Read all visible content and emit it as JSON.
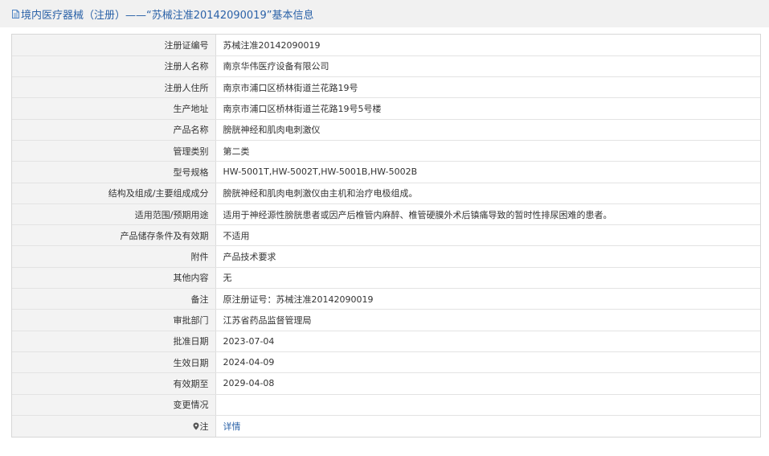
{
  "header": {
    "icon": "document-icon",
    "title": "境内医疗器械（注册）——“苏械注准20142090019”基本信息",
    "accent_color": "#2b62a8"
  },
  "rows": [
    {
      "label": "注册证编号",
      "value": "苏械注准20142090019"
    },
    {
      "label": "注册人名称",
      "value": "南京华伟医疗设备有限公司"
    },
    {
      "label": "注册人住所",
      "value": "南京市浦口区桥林街道兰花路19号"
    },
    {
      "label": "生产地址",
      "value": "南京市浦口区桥林街道兰花路19号5号楼"
    },
    {
      "label": "产品名称",
      "value": "膀胱神经和肌肉电刺激仪"
    },
    {
      "label": "管理类别",
      "value": "第二类"
    },
    {
      "label": "型号规格",
      "value": "HW-5001T,HW-5002T,HW-5001B,HW-5002B"
    },
    {
      "label": "结构及组成/主要组成成分",
      "value": "膀胱神经和肌肉电刺激仪由主机和治疗电极组成。"
    },
    {
      "label": "适用范围/预期用途",
      "value": "适用于神经源性膀胱患者或因产后椎管内麻醉、椎管硬膜外术后镇痛导致的暂时性排尿困难的患者。"
    },
    {
      "label": "产品储存条件及有效期",
      "value": "不适用"
    },
    {
      "label": "附件",
      "value": "产品技术要求"
    },
    {
      "label": "其他内容",
      "value": "无"
    },
    {
      "label": "备注",
      "value": "原注册证号：苏械注准20142090019"
    },
    {
      "label": "审批部门",
      "value": "江苏省药品监督管理局"
    },
    {
      "label": "批准日期",
      "value": "2023-07-04"
    },
    {
      "label": "生效日期",
      "value": "2024-04-09"
    },
    {
      "label": "有效期至",
      "value": "2029-04-08"
    },
    {
      "label": "变更情况",
      "value": ""
    }
  ],
  "note_row": {
    "icon": "map-pin-icon",
    "label": "注",
    "link_text": "详情"
  }
}
